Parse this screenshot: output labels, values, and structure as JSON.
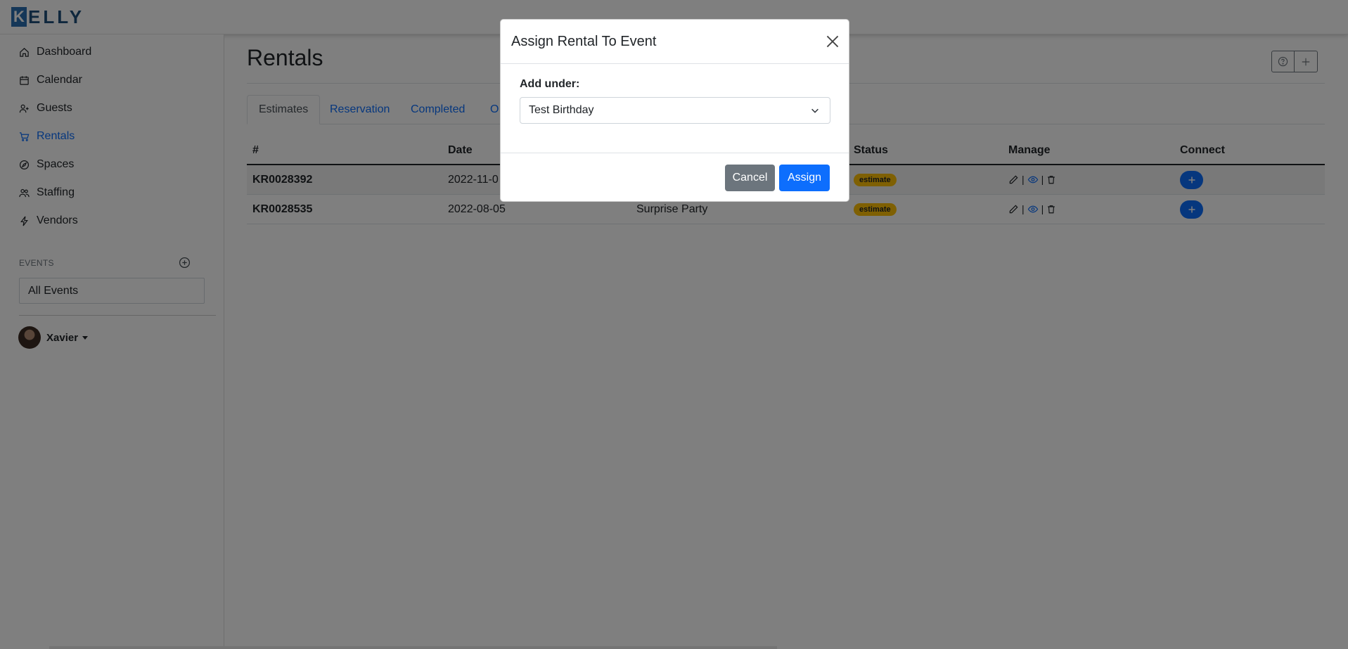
{
  "app": {
    "logo_initial": "K",
    "logo_rest": "ELLY"
  },
  "sidebar": {
    "items": [
      {
        "label": "Dashboard",
        "icon": "home-icon",
        "active": false
      },
      {
        "label": "Calendar",
        "icon": "calendar-icon",
        "active": false
      },
      {
        "label": "Guests",
        "icon": "person-add-icon",
        "active": false
      },
      {
        "label": "Rentals",
        "icon": "cart-icon",
        "active": true
      },
      {
        "label": "Spaces",
        "icon": "compass-icon",
        "active": false
      },
      {
        "label": "Staffing",
        "icon": "people-icon",
        "active": false
      },
      {
        "label": "Vendors",
        "icon": "lightning-icon",
        "active": false
      }
    ],
    "events_label": "EVENTS",
    "events_select_value": "All Events",
    "user_name": "Xavier"
  },
  "main": {
    "title": "Rentals",
    "tabs": [
      {
        "label": "Estimates",
        "active": true
      },
      {
        "label": "Reservation",
        "active": false
      },
      {
        "label": "Completed",
        "active": false
      },
      {
        "label": "O",
        "active": false
      }
    ],
    "table": {
      "headers": [
        "#",
        "Date",
        "Status",
        "Manage",
        "Connect"
      ],
      "rows": [
        {
          "id": "KR0028392",
          "date": "2022-11-0",
          "event": "",
          "status": "estimate"
        },
        {
          "id": "KR0028535",
          "date": "2022-08-05",
          "event": "Surprise Party",
          "status": "estimate"
        }
      ]
    }
  },
  "modal": {
    "title": "Assign Rental To Event",
    "label": "Add under:",
    "select_value": "Test Birthday",
    "cancel_label": "Cancel",
    "assign_label": "Assign"
  },
  "colors": {
    "primary": "#0d6efd",
    "secondary": "#6c757d",
    "warning": "#ffc107"
  }
}
